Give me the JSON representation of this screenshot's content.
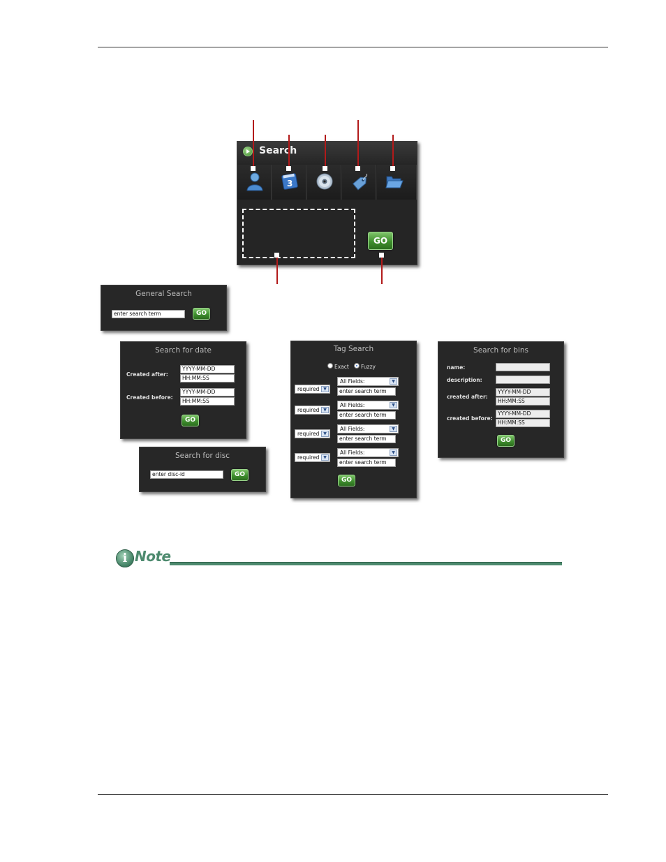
{
  "main_search": {
    "title": "Search",
    "go_label": "GO",
    "tabs": [
      {
        "name": "user-icon"
      },
      {
        "name": "date-icon",
        "glyph": "3"
      },
      {
        "name": "disc-icon"
      },
      {
        "name": "tag-icon"
      },
      {
        "name": "folder-icon"
      }
    ]
  },
  "general_search": {
    "title": "General Search",
    "input_value": "enter search term",
    "go_label": "GO"
  },
  "date_search": {
    "title": "Search for date",
    "created_after_label": "Created after:",
    "created_after_date": "YYYY-MM-DD",
    "created_after_time": "HH:MM:SS",
    "created_before_label": "Created before:",
    "created_before_date": "YYYY-MM-DD",
    "created_before_time": "HH:MM:SS",
    "go_label": "GO"
  },
  "disc_search": {
    "title": "Search for disc",
    "input_value": "enter disc-id",
    "go_label": "GO"
  },
  "tag_search": {
    "title": "Tag Search",
    "radio_exact": "Exact",
    "radio_fuzzy": "Fuzzy",
    "rows": [
      {
        "required": "required",
        "field": "All Fields:",
        "term": "enter search term"
      },
      {
        "required": "required",
        "field": "All Fields:",
        "term": "enter search term"
      },
      {
        "required": "required",
        "field": "All Fields:",
        "term": "enter search term"
      },
      {
        "required": "required",
        "field": "All Fields:",
        "term": "enter search term"
      }
    ],
    "go_label": "GO"
  },
  "bins_search": {
    "title": "Search for bins",
    "name_label": "name:",
    "description_label": "description:",
    "created_after_label": "created after:",
    "created_after_date": "YYYY-MM-DD",
    "created_after_time": "HH:MM:SS",
    "created_before_label": "created before:",
    "created_before_date": "YYYY-MM-DD",
    "created_before_time": "HH:MM:SS",
    "go_label": "GO"
  },
  "note": {
    "heading": "Note"
  },
  "colors": {
    "panel_bg": "#272727",
    "go_green": "#3f8f2e",
    "callout_red": "#b21a1a",
    "note_green": "#4d8a6e"
  }
}
